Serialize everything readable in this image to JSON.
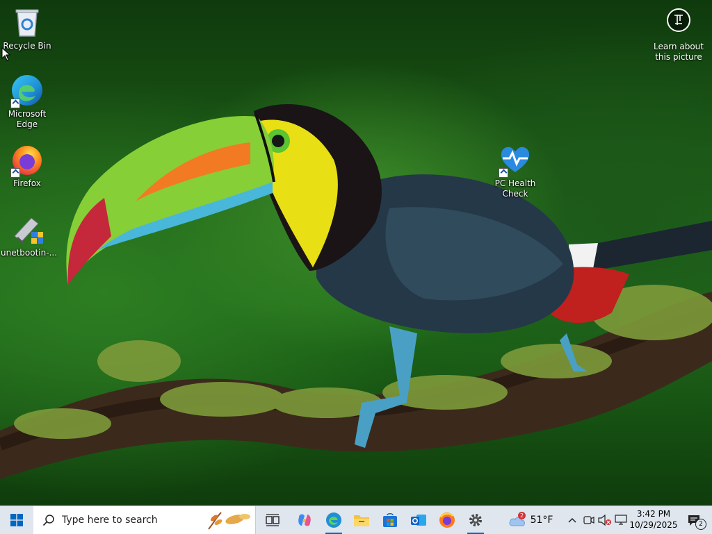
{
  "desktop": {
    "icons": [
      {
        "label": "Recycle Bin"
      },
      {
        "label": "Microsoft Edge"
      },
      {
        "label": "Firefox"
      },
      {
        "label": "unetbootin-..."
      },
      {
        "label": "PC Health Check"
      }
    ],
    "learn_label": "Learn about this picture"
  },
  "taskbar": {
    "search_placeholder": "Type here to search",
    "weather": {
      "temp": "51°F",
      "badge": "2"
    },
    "clock": {
      "time": "3:42 PM",
      "date": "10/29/2025"
    },
    "notifications_count": "2"
  },
  "colors": {
    "taskbar_bg": "#dfe6ee",
    "accent": "#0067c0",
    "wallpaper_green": "#1f6b1a"
  }
}
